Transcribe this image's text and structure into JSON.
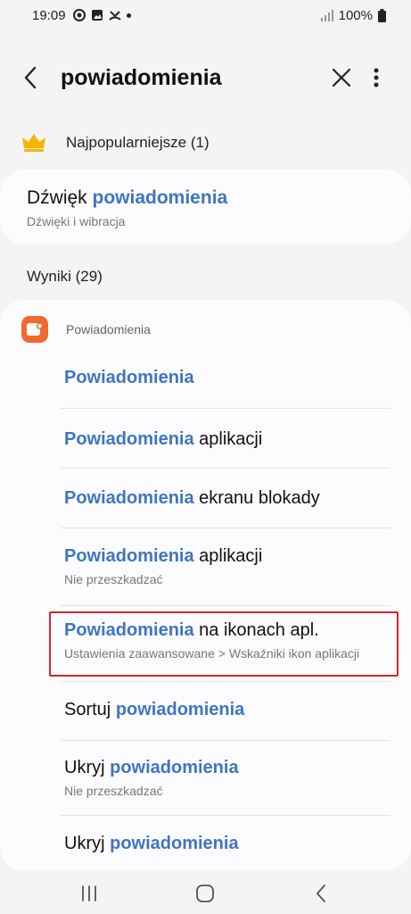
{
  "status": {
    "time": "19:09",
    "battery": "100%"
  },
  "search": {
    "query": "powiadomienia"
  },
  "popular": {
    "header": "Najpopularniejsze (1)",
    "item": {
      "title_plain": "Dźwięk ",
      "title_highlight": "powiadomienia",
      "subtitle": "Dźwięki i wibracja"
    }
  },
  "results": {
    "header": "Wyniki (29)",
    "section_label": "Powiadomienia",
    "items": [
      {
        "highlight": "Powiadomienia",
        "rest": "",
        "subtitle": ""
      },
      {
        "highlight": "Powiadomienia",
        "rest": " aplikacji",
        "subtitle": ""
      },
      {
        "highlight": "Powiadomienia",
        "rest": " ekranu blokady",
        "subtitle": ""
      },
      {
        "highlight": "Powiadomienia",
        "rest": " aplikacji",
        "subtitle": "Nie przeszkadzać"
      },
      {
        "highlight": "Powiadomienia",
        "rest": " na ikonach apl.",
        "subtitle": "Ustawienia zaawansowane > Wskaźniki ikon aplikacji"
      },
      {
        "prefix": "Sortuj ",
        "highlight": "powiadomienia",
        "subtitle": ""
      },
      {
        "prefix": "Ukryj ",
        "highlight": "powiadomienia",
        "subtitle": "Nie przeszkadzać"
      },
      {
        "prefix": "Ukryj ",
        "highlight": "powiadomienia",
        "subtitle": ""
      }
    ]
  },
  "colors": {
    "accent": "#3f75c2",
    "highlight_box": "#d7262c",
    "app_icon": "#ef6a2e",
    "crown": "#f4b400"
  }
}
